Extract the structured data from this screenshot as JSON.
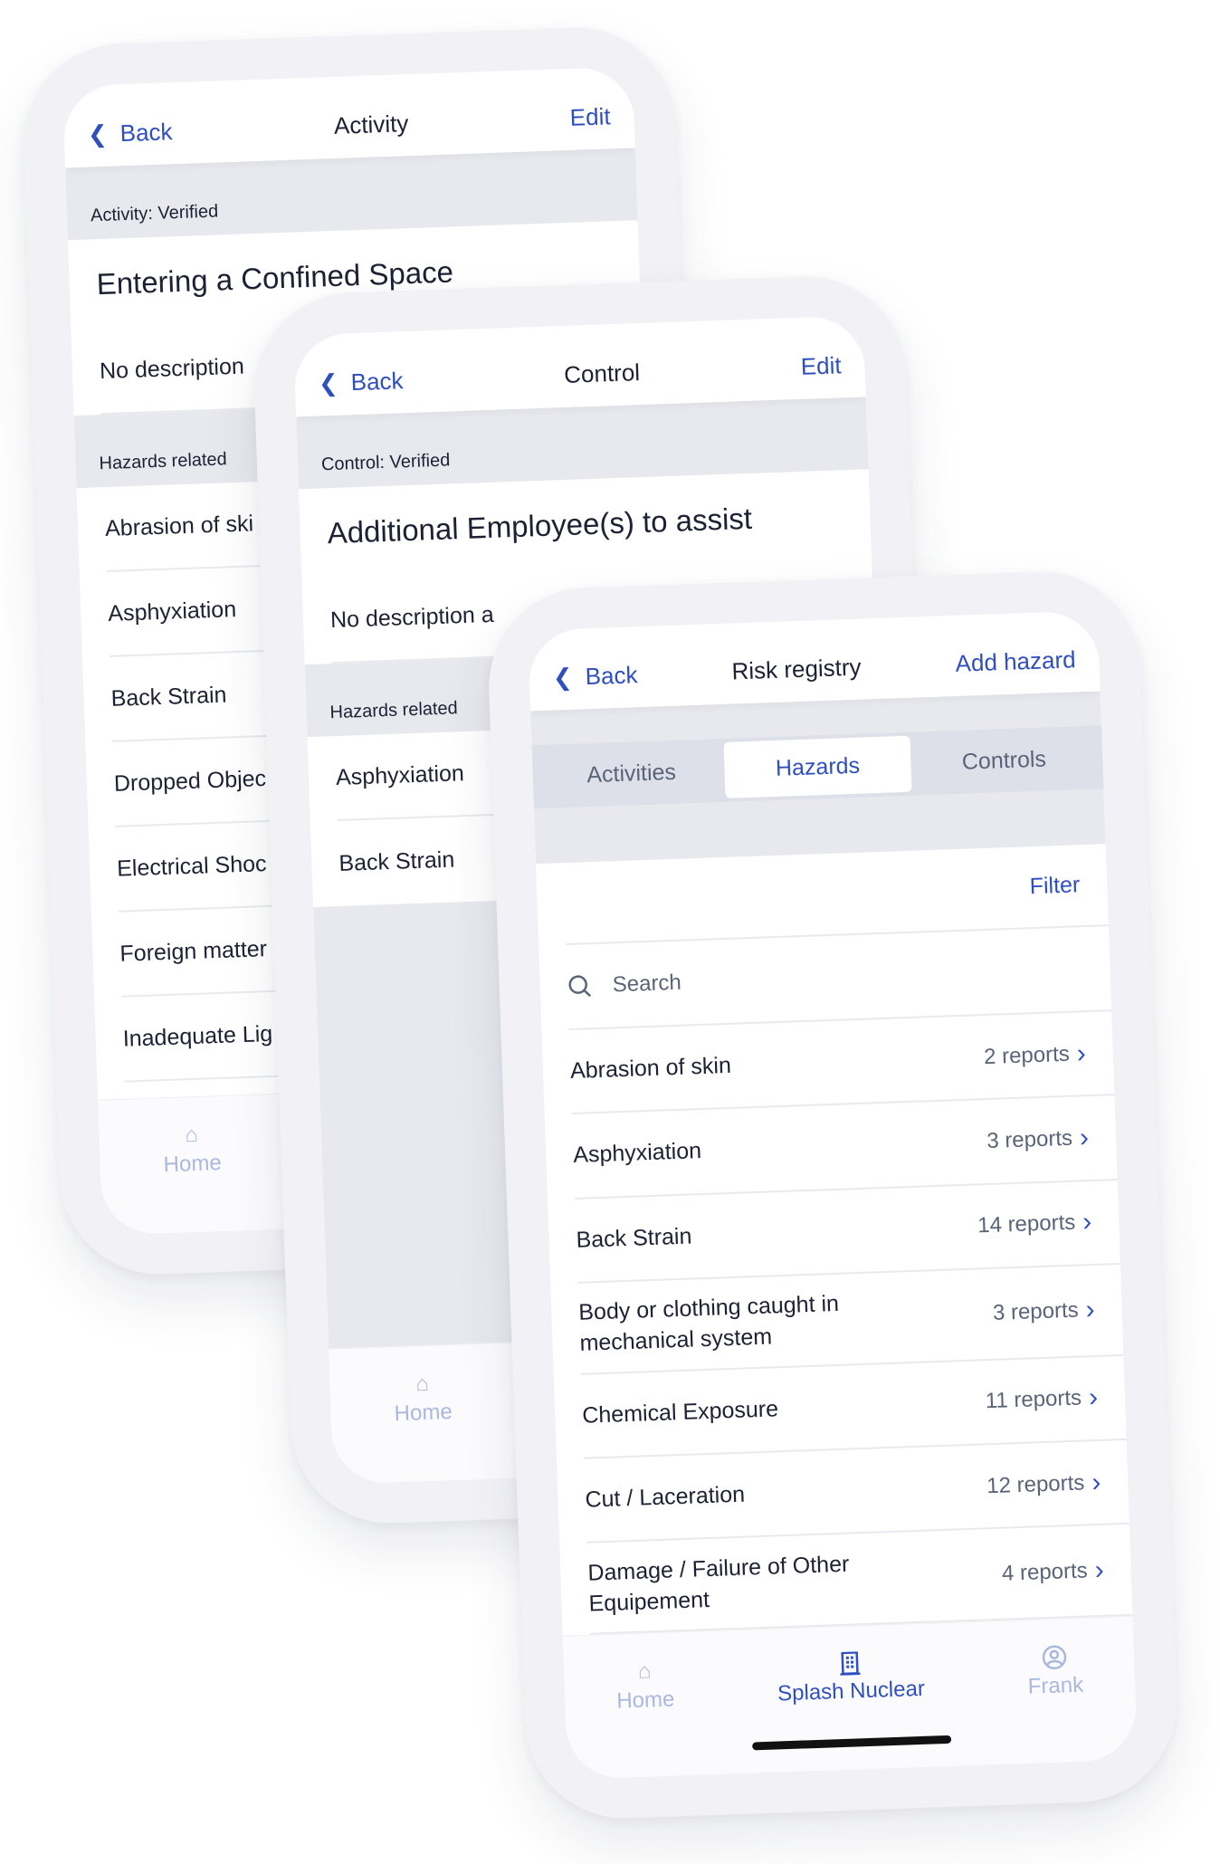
{
  "colors": {
    "accent": "#2f4fbf",
    "band": "#e7e9ee",
    "inactive_tab": "#aab8e0"
  },
  "activity": {
    "back": "Back",
    "title": "Activity",
    "edit": "Edit",
    "status": "Activity: Verified",
    "name": "Entering a Confined Space",
    "description": "No description",
    "hazards_label": "Hazards related",
    "hazards": [
      "Abrasion of ski",
      "Asphyxiation",
      "Back Strain",
      "Dropped Objec",
      "Electrical Shoc",
      "Foreign matter",
      "Inadequate Lig"
    ],
    "tab_home": "Home"
  },
  "control": {
    "back": "Back",
    "title": "Control",
    "edit": "Edit",
    "status": "Control: Verified",
    "name": "Additional Employee(s) to assist",
    "description": "No description a",
    "hazards_label": "Hazards related",
    "hazards": [
      "Asphyxiation",
      "Back Strain"
    ],
    "tab_home": "Home"
  },
  "registry": {
    "back": "Back",
    "title": "Risk registry",
    "add": "Add hazard",
    "tabs": [
      "Activities",
      "Hazards",
      "Controls"
    ],
    "active_tab": "Hazards",
    "filter": "Filter",
    "search_placeholder": "Search",
    "hazards": [
      {
        "name": "Abrasion of skin",
        "count": "2 reports"
      },
      {
        "name": "Asphyxiation",
        "count": "3 reports"
      },
      {
        "name": "Back Strain",
        "count": "14 reports"
      },
      {
        "name": "Body or clothing caught in mechanical system",
        "count": "3 reports"
      },
      {
        "name": "Chemical Exposure",
        "count": "11 reports"
      },
      {
        "name": "Cut / Laceration",
        "count": "12 reports"
      },
      {
        "name": "Damage / Failure of Other Equipement",
        "count": "4 reports"
      }
    ],
    "tabbar": {
      "home": "Home",
      "org": "Splash Nuclear",
      "user": "Frank"
    }
  }
}
